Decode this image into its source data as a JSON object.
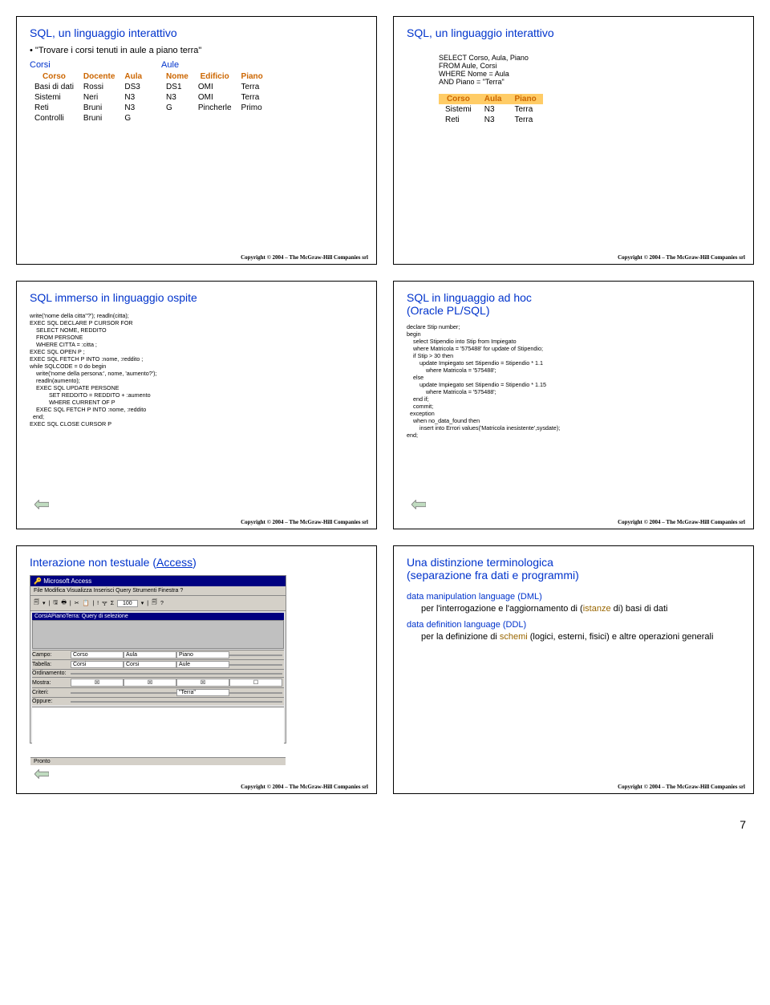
{
  "copyright": "Copyright © 2004 – The McGraw-Hill Companies srl",
  "pagenum": "7",
  "s1": {
    "title": "SQL, un linguaggio interattivo",
    "bullet": "\"Trovare i corsi tenuti in aule a piano terra\"",
    "corsi": {
      "name": "Corsi",
      "h": [
        "Corso",
        "Docente",
        "Aula"
      ],
      "r": [
        [
          "Basi di dati",
          "Rossi",
          "DS3"
        ],
        [
          "Sistemi",
          "Neri",
          "N3"
        ],
        [
          "Reti",
          "Bruni",
          "N3"
        ],
        [
          "Controlli",
          "Bruni",
          "G"
        ]
      ]
    },
    "aule": {
      "name": "Aule",
      "h": [
        "Nome",
        "Edificio",
        "Piano"
      ],
      "r": [
        [
          "DS1",
          "OMI",
          "Terra"
        ],
        [
          "N3",
          "OMI",
          "Terra"
        ],
        [
          "G",
          "Pincherle",
          "Primo"
        ]
      ]
    }
  },
  "s2": {
    "title": "SQL, un linguaggio interattivo",
    "sql": "SELECT Corso, Aula, Piano\nFROM Aule, Corsi\nWHERE Nome = Aula\nAND Piano = \"Terra\"",
    "res": {
      "h": [
        "Corso",
        "Aula",
        "Piano"
      ],
      "r": [
        [
          "Sistemi",
          "N3",
          "Terra"
        ],
        [
          "Reti",
          "N3",
          "Terra"
        ]
      ]
    }
  },
  "s3": {
    "title": "SQL immerso in linguaggio ospite",
    "code": "write('nome della citta''?'); readln(citta);\nEXEC SQL DECLARE P CURSOR FOR\n    SELECT NOME, REDDITO\n    FROM PERSONE\n    WHERE CITTA = :citta ;\nEXEC SQL OPEN P ;\nEXEC SQL FETCH P INTO :nome, :reddito ;\nwhile SQLCODE = 0 do begin\n    write('nome della persona:', nome, 'aumento?');\n    readln(aumento);\n    EXEC SQL UPDATE PERSONE\n            SET REDDITO = REDDITO + :aumento\n            WHERE CURRENT OF P\n    EXEC SQL FETCH P INTO :nome, :reddito\n  end;\nEXEC SQL CLOSE CURSOR P"
  },
  "s4": {
    "title": "SQL in linguaggio ad hoc\n(Oracle PL/SQL)",
    "code": "declare Stip number;\nbegin\n    select Stipendio into Stip from Impiegato\n    where Matricola = '575488' for update of Stipendio;\n    if Stip > 30 then\n        update Impiegato set Stipendio = Stipendio * 1.1\n            where Matricola = '575488';\n    else\n        update Impiegato set Stipendio = Stipendio * 1.15\n            where Matricola = '575488';\n    end if;\n    commit;\n  exception\n    when no_data_found then\n        insert into Errori values('Matricola inesistente',sysdate);\nend;"
  },
  "s5": {
    "title_pre": "Interazione non testuale (",
    "link": "Access",
    "title_post": ")",
    "app_title": "Microsoft Access",
    "menu": "File  Modifica  Visualizza  Inserisci  Query  Strumenti  Finestra  ?",
    "inner_title": "CorsiAPianoTerra: Query di selezione",
    "labels": [
      "Campo:",
      "Tabella:",
      "Ordinamento:",
      "Mostra:",
      "Criteri:",
      "Oppure:"
    ],
    "g": {
      "r0": [
        "Corso",
        "Aula",
        "Piano",
        ""
      ],
      "r1": [
        "Corsi",
        "Corsi",
        "Aule",
        ""
      ],
      "r4": [
        "",
        "",
        "\"Terra\"",
        ""
      ]
    },
    "status": "Pronto"
  },
  "s6": {
    "title": "Una distinzione terminologica\n(separazione fra dati e programmi)",
    "l1": "data manipulation language (DML)",
    "l1a": "per l'interrogazione e l'aggiornamento di (",
    "l1b": "istanze",
    "l1c": " di) basi di dati",
    "l2": "data definition language (DDL)",
    "l2a": "per la definizione di ",
    "l2b": "schemi",
    "l2c": " (logici, esterni, fisici) e altre operazioni generali"
  }
}
